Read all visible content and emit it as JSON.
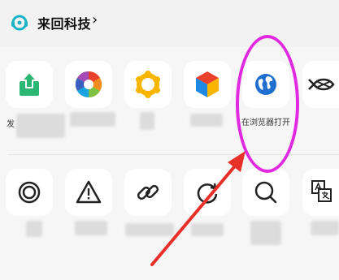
{
  "header": {
    "title": "来回科技",
    "chevron": "›",
    "logo_icon": "headset-logo-icon"
  },
  "share_row": [
    {
      "icon": "share-upload-icon",
      "label": "发"
    },
    {
      "icon": "camera-aperture-icon",
      "label": ""
    },
    {
      "icon": "yellow-ring-icon",
      "label": ""
    },
    {
      "icon": "color-cube-icon",
      "label": ""
    },
    {
      "icon": "globe-browser-icon",
      "label": "在浏览器打开"
    },
    {
      "icon": "fish-icon",
      "label": ""
    }
  ],
  "action_row": [
    {
      "icon": "circle-target-icon"
    },
    {
      "icon": "warning-icon"
    },
    {
      "icon": "link-icon"
    },
    {
      "icon": "refresh-icon"
    },
    {
      "icon": "search-icon"
    },
    {
      "icon": "translate-icon"
    }
  ],
  "annotation": {
    "color": "#e02ae0",
    "arrow_color": "#e8302a"
  }
}
